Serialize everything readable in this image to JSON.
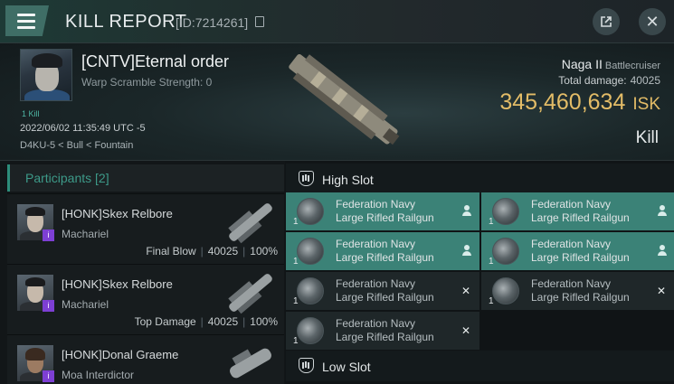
{
  "header": {
    "title": "KILL REPORT",
    "report_id": "[ID:7214261]",
    "icons": [
      "hamburger-menu-icon",
      "copy-icon",
      "share-icon",
      "close-icon"
    ]
  },
  "victim": {
    "name": "[CNTV]Eternal order",
    "warp_scramble": "Warp Scramble Strength: 0",
    "kill_tag": "1 Kill",
    "datetime": "2022/06/02 11:35:49 UTC -5",
    "location": "D4KU-5 < Bull < Fountain",
    "ship_name": "Naga II",
    "ship_class": "Battlecruiser",
    "total_damage_label": "Total damage:",
    "total_damage": "40025",
    "isk_value": "345,460,634",
    "isk_unit": "ISK",
    "result": "Kill"
  },
  "participants": {
    "header": "Participants [2]",
    "list": [
      {
        "name": "[HONK]Skex Relbore",
        "ship": "Machariel",
        "role": "Final Blow",
        "damage": "40025",
        "percent": "100%"
      },
      {
        "name": "[HONK]Skex Relbore",
        "ship": "Machariel",
        "role": "Top Damage",
        "damage": "40025",
        "percent": "100%"
      },
      {
        "name": "[HONK]Donal Graeme",
        "ship": "Moa Interdictor",
        "role": "",
        "damage": "",
        "percent": ""
      }
    ],
    "corp_badge": "i"
  },
  "fitting": {
    "high_slot_label": "High Slot",
    "low_slot_label": "Low Slot",
    "modules": [
      {
        "line1": "Federation Navy",
        "line2": "Large Rifled Railgun",
        "qty": "1",
        "state": "dropped"
      },
      {
        "line1": "Federation Navy",
        "line2": "Large Rifled Railgun",
        "qty": "1",
        "state": "dropped"
      },
      {
        "line1": "Federation Navy",
        "line2": "Large Rifled Railgun",
        "qty": "1",
        "state": "dropped"
      },
      {
        "line1": "Federation Navy",
        "line2": "Large Rifled Railgun",
        "qty": "1",
        "state": "dropped"
      },
      {
        "line1": "Federation Navy",
        "line2": "Large Rifled Railgun",
        "qty": "1",
        "state": "destroyed"
      },
      {
        "line1": "Federation Navy",
        "line2": "Large Rifled Railgun",
        "qty": "1",
        "state": "destroyed"
      },
      {
        "line1": "Federation Navy",
        "line2": "Large Rifled Railgun",
        "qty": "1",
        "state": "destroyed"
      }
    ],
    "destroyed_mark": "✕"
  },
  "colors": {
    "accent_teal": "#3b8277",
    "isk_gold": "#e3bc67",
    "corp_purple": "#7d3fd4"
  }
}
